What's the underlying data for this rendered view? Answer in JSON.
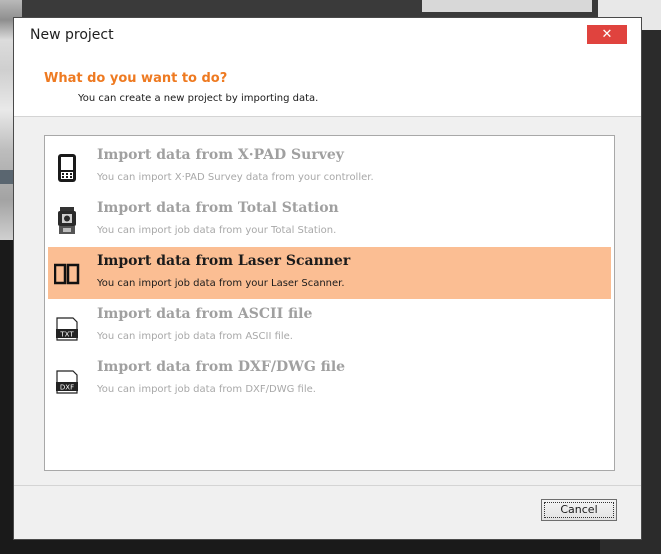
{
  "dialog": {
    "title": "New project",
    "close_glyph": "✕",
    "heading": "What do you want to do?",
    "subheading": "You can create a new project by importing data.",
    "options": [
      {
        "title": "Import data from X·PAD Survey",
        "description": "You can import X·PAD Survey data from your controller.",
        "icon": "controller-icon",
        "selected": false
      },
      {
        "title": "Import data from Total Station",
        "description": "You can import job data from your Total Station.",
        "icon": "total-station-icon",
        "selected": false
      },
      {
        "title": "Import data from Laser Scanner",
        "description": "You can import job data from your Laser Scanner.",
        "icon": "laser-scanner-icon",
        "selected": true
      },
      {
        "title": "Import data from ASCII file",
        "description": "You can import job data from ASCII file.",
        "icon": "txt-file-icon",
        "icon_text": "TXT",
        "selected": false
      },
      {
        "title": "Import data from DXF/DWG file",
        "description": "You can import job data from DXF/DWG file.",
        "icon": "dxf-file-icon",
        "icon_text": "DXF",
        "selected": false
      }
    ],
    "cancel_label": "Cancel"
  },
  "colors": {
    "accent": "#ee7a21",
    "selection": "#fbbe93",
    "close": "#e0433e"
  }
}
